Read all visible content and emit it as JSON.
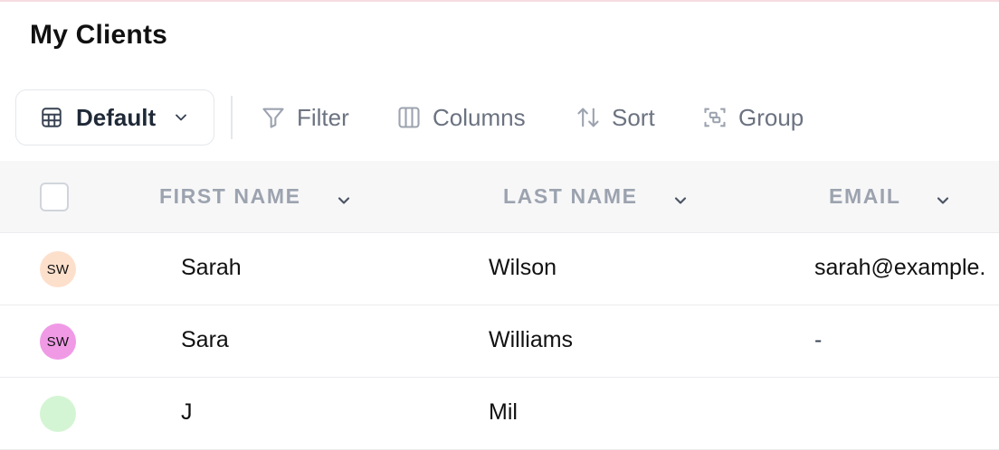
{
  "page": {
    "title": "My Clients"
  },
  "toolbar": {
    "view": {
      "label": "Default",
      "icon": "table-grid-icon"
    },
    "filter": {
      "label": "Filter",
      "icon": "filter-icon"
    },
    "columns": {
      "label": "Columns",
      "icon": "columns-icon"
    },
    "sort": {
      "label": "Sort",
      "icon": "sort-arrows-icon"
    },
    "group": {
      "label": "Group",
      "icon": "group-icon"
    }
  },
  "table": {
    "headers": {
      "first_name": "FIRST NAME",
      "last_name": "LAST NAME",
      "email": "EMAIL"
    },
    "rows": [
      {
        "initials": "SW",
        "avatar_color": "#fde0cc",
        "first_name": "Sarah",
        "last_name": "Wilson",
        "email": "sarah@example."
      },
      {
        "initials": "SW",
        "avatar_color": "#f09ae6",
        "first_name": "Sara",
        "last_name": "Williams",
        "email": "-"
      },
      {
        "initials": "",
        "avatar_color": "#d4f5d4",
        "first_name": "J",
        "last_name": "Mil",
        "email": ""
      }
    ]
  },
  "colors": {
    "accent_top": "#f6dde2",
    "header_bg": "#f7f7f8",
    "muted_text": "#9ca3af",
    "toolbar_text": "#6b7280"
  }
}
